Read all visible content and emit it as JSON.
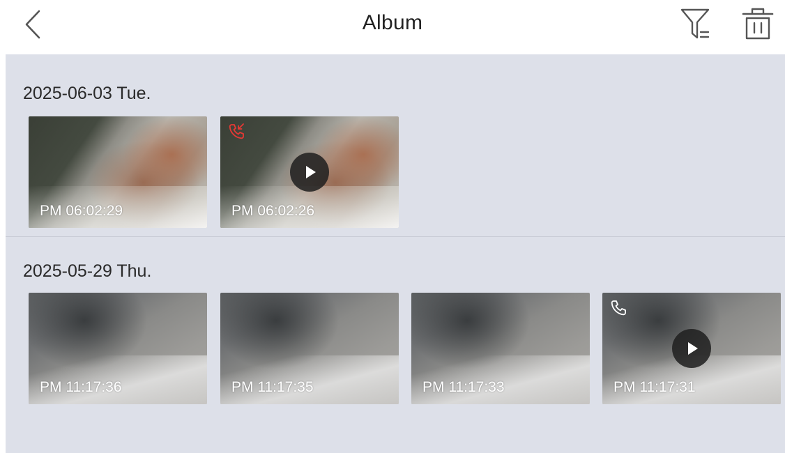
{
  "header": {
    "title": "Album",
    "back_icon": "chevron-left-icon",
    "filter_icon": "filter-icon",
    "delete_icon": "trash-icon"
  },
  "colors": {
    "background": "#dde0e9",
    "header_bg": "#ffffff",
    "missed_call": "#e53935",
    "play_bg": "#1e1e1e"
  },
  "groups": [
    {
      "date": "2025-06-03 Tue.",
      "items": [
        {
          "time": "PM 06:02:29",
          "type": "photo",
          "call_icon": ""
        },
        {
          "time": "PM 06:02:26",
          "type": "video",
          "call_icon": "missed-call-icon"
        }
      ]
    },
    {
      "date": "2025-05-29 Thu.",
      "items": [
        {
          "time": "PM 11:17:36",
          "type": "photo",
          "call_icon": ""
        },
        {
          "time": "PM 11:17:35",
          "type": "photo",
          "call_icon": ""
        },
        {
          "time": "PM 11:17:33",
          "type": "photo",
          "call_icon": ""
        },
        {
          "time": "PM 11:17:31",
          "type": "video",
          "call_icon": "call-icon"
        }
      ]
    }
  ]
}
